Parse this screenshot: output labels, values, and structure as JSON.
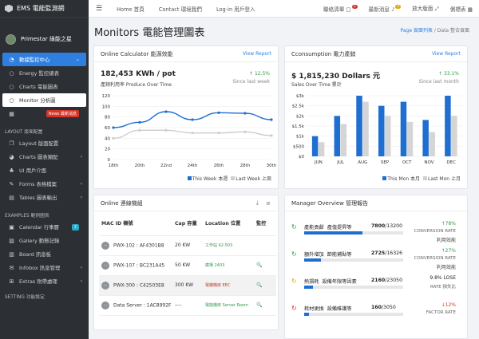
{
  "brand": "EMS 電能監測網",
  "user": "Primestar 綠能之星",
  "sidebar": {
    "dashboard": "數據監控中心",
    "sub": [
      "Energy 監控總表",
      "Charts 電能圖表",
      "Monitor 分析圖"
    ],
    "news": "News 最新消息",
    "section1": "LAYOUT 版面配置",
    "items1": [
      "Layout 版面配置",
      "Charts 圖表類配",
      "UI 用戶介面",
      "Forms 表格檔案",
      "Tables 圖表輸出"
    ],
    "section2": "EXAMPLES 範例圖表",
    "items2": [
      "Calendar 行事曆",
      "Gallery 動態記錄",
      "Board 訊息板",
      "Infobox 訊息管理",
      "Extras 附帶處理"
    ],
    "calendar_badge": "2",
    "section3": "SETTING 功能設定"
  },
  "topbar": {
    "nav": [
      "Home 首頁",
      "Contact 環境我們",
      "Log-in 用戶登入"
    ],
    "right": [
      "聯絡清單",
      "最新消息",
      "放大版面",
      "側標表"
    ],
    "badge1": "1",
    "badge2": "3"
  },
  "page": {
    "title": "Monitors 電能管理圖表",
    "crumb_link": "Page 頁面列表",
    "crumb_current": "Data 整合頁面"
  },
  "card1": {
    "title": "Online Calculator 能源效能",
    "link": "View Report",
    "kpi": "182,453 KWh / pot",
    "kpi_sub": "產銷利用率 Produce Over Time",
    "trend": "12.5%",
    "trend_sub": "Since last week",
    "legend": [
      "This Week 本週",
      "Last Week 上周"
    ]
  },
  "card2": {
    "title": "Cconsumption 電力產銷",
    "link": "View Report",
    "kpi": "$ 1,815,230 Dollars 元",
    "kpi_sub": "Sales Over Time 累計",
    "trend": "33.1%",
    "trend_sub": "Since last month",
    "legend": [
      "This Mon 本月",
      "Last Mon 上月"
    ]
  },
  "card3": {
    "title": "Online 連線機組",
    "headers": [
      "MAC ID 機號",
      "Cap 容量",
      "Location 位置",
      "監控"
    ],
    "rows": [
      {
        "mac": "PWX-102 : AF4301B8",
        "cap": "20 KW",
        "loc": "工作站 42-503",
        "lc": "g",
        "act": ""
      },
      {
        "mac": "PWX-107 : BC231A45",
        "cap": "50 KW",
        "loc": "廣場 2403",
        "lc": "g",
        "act": "🔍"
      },
      {
        "mac": "PWX-300 : C42503E8",
        "cap": "300 KW",
        "loc": "電廠機房 EEC",
        "lc": "r",
        "act": "🔍"
      },
      {
        "mac": "Data Server : 1AC8992F",
        "cap": "----",
        "loc": "電能機房 Server Room",
        "lc": "g",
        "act": "🔍"
      }
    ]
  },
  "card4": {
    "title": "Manager Overview 管理報告",
    "rows": [
      {
        "label": "產能貢獻",
        "sub": "產值提昇等",
        "val": "7800",
        "of": "13200",
        "pct": "↑78%",
        "pctc": "#2e9d46",
        "rate": "CONVERSION RATE",
        "rate2": "利用效能",
        "fill": 59,
        "ic": "↻",
        "icc": "#2e9d46"
      },
      {
        "label": "額外增加",
        "sub": "節能補貼等",
        "val": "2725",
        "of": "16326",
        "pct": "↑27%",
        "pctc": "#2e9d46",
        "rate": "CONVERSION RATE",
        "rate2": "利用效能",
        "fill": 17,
        "ic": "↻",
        "icc": "#2e9d46"
      },
      {
        "label": "熱損耗",
        "sub": "設備年限等因素",
        "val": "2160",
        "of": "23050",
        "pct": "9.8% LOSE",
        "pctc": "#222",
        "rate": "RATE 損失比",
        "rate2": "",
        "fill": 9,
        "ic": "↻",
        "icc": "#e0a800"
      },
      {
        "label": "耗材更換",
        "sub": "設備維護等",
        "val": "160",
        "of": "3050",
        "pct": "↓12%",
        "pctc": "#d9342b",
        "rate": "FACTOR RATE",
        "rate2": "",
        "fill": 5,
        "ic": "↻",
        "icc": "#d9342b"
      }
    ]
  },
  "chart_data": [
    {
      "type": "line",
      "title": "",
      "x": [
        "18th",
        "20th",
        "22nd",
        "24th",
        "26th",
        "28th",
        "30th"
      ],
      "series": [
        {
          "name": "This Week 本週",
          "color": "#1f6fd0",
          "values": [
            60,
            70,
            90,
            75,
            88,
            87,
            75
          ]
        },
        {
          "name": "Last Week 上周",
          "color": "#cccccc",
          "values": [
            40,
            55,
            55,
            50,
            50,
            52,
            45
          ]
        }
      ],
      "ylim": [
        0,
        120
      ],
      "yticks": [
        0,
        20,
        40,
        60,
        80,
        100,
        120
      ]
    },
    {
      "type": "bar",
      "categories": [
        "JUN",
        "JUL",
        "AUG",
        "SEP",
        "OCT",
        "NOV",
        "DEC"
      ],
      "series": [
        {
          "name": "This Mon 本月",
          "color": "#1f6fd0",
          "values": [
            1000,
            2000,
            3000,
            2500,
            2700,
            1800,
            3000
          ]
        },
        {
          "name": "Last Mon 上月",
          "color": "#d5d5d5",
          "values": [
            700,
            1600,
            2700,
            2000,
            1700,
            1200,
            2000
          ]
        }
      ],
      "ylim": [
        0,
        3000
      ],
      "yticks": [
        "$0",
        "$500",
        "$1k",
        "$1.5k",
        "$2k",
        "$2.5k",
        "$3k"
      ]
    }
  ]
}
